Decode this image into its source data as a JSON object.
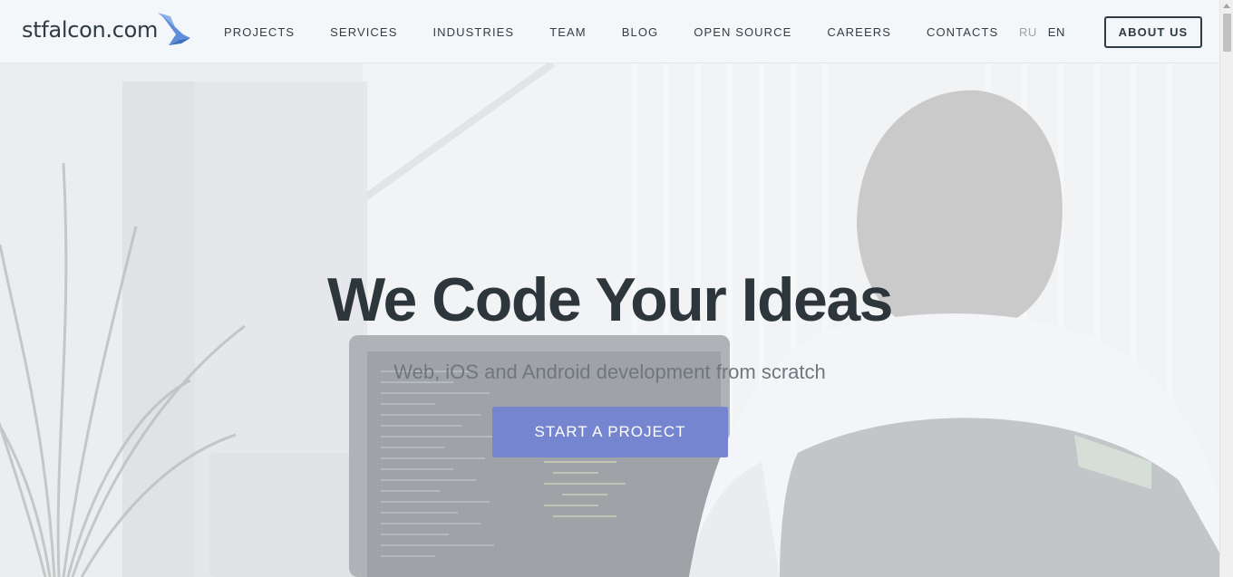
{
  "brand": {
    "logo_text": "stfalcon.com",
    "logo_icon": "falcon-bird-icon",
    "accent_color": "#7685cf"
  },
  "nav": {
    "items": [
      {
        "label": "PROJECTS"
      },
      {
        "label": "SERVICES"
      },
      {
        "label": "INDUSTRIES"
      },
      {
        "label": "TEAM"
      },
      {
        "label": "BLOG"
      },
      {
        "label": "OPEN SOURCE"
      },
      {
        "label": "CAREERS"
      },
      {
        "label": "CONTACTS"
      }
    ]
  },
  "languages": {
    "ru": "RU",
    "en": "EN",
    "active": "EN"
  },
  "header": {
    "about_button": "ABOUT US"
  },
  "hero": {
    "title": "We Code Your Ideas",
    "subtitle": "Web, iOS and Android development from scratch",
    "cta_label": "START A PROJECT",
    "background": "office-developer-photo"
  }
}
